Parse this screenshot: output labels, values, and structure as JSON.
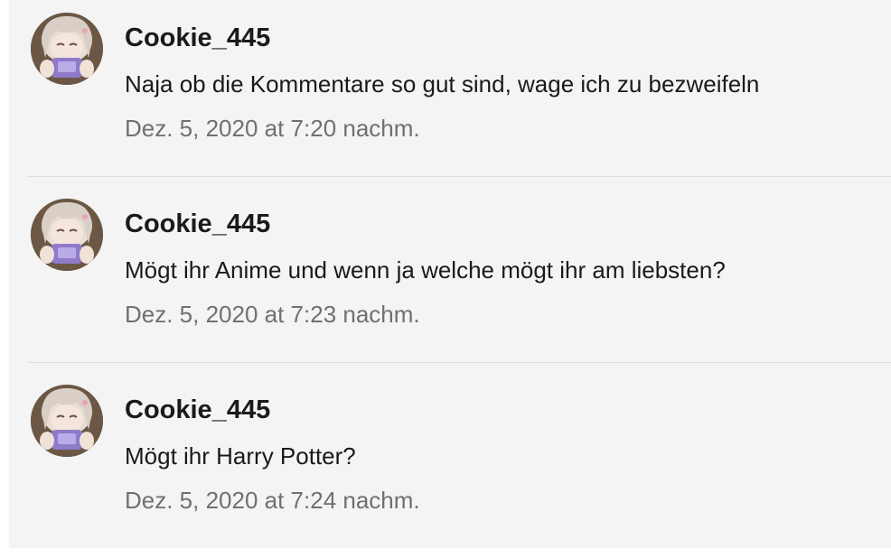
{
  "comments": [
    {
      "username": "Cookie_445",
      "text": "Naja ob die Kommentare so gut sind, wage ich zu bezweifeln",
      "timestamp": "Dez. 5, 2020 at 7:20 nachm.",
      "avatar_icon": "anime-avatar-icon"
    },
    {
      "username": "Cookie_445",
      "text": "Mögt ihr Anime und wenn ja welche mögt ihr am liebsten?",
      "timestamp": "Dez. 5, 2020 at 7:23 nachm.",
      "avatar_icon": "anime-avatar-icon"
    },
    {
      "username": "Cookie_445",
      "text": "Mögt ihr Harry Potter?",
      "timestamp": "Dez. 5, 2020 at 7:24 nachm.",
      "avatar_icon": "anime-avatar-icon"
    }
  ],
  "colors": {
    "background": "#f4f4f4",
    "username": "#1a1a1a",
    "text": "#1a1a1a",
    "timestamp": "#707070",
    "divider": "#dedede"
  }
}
